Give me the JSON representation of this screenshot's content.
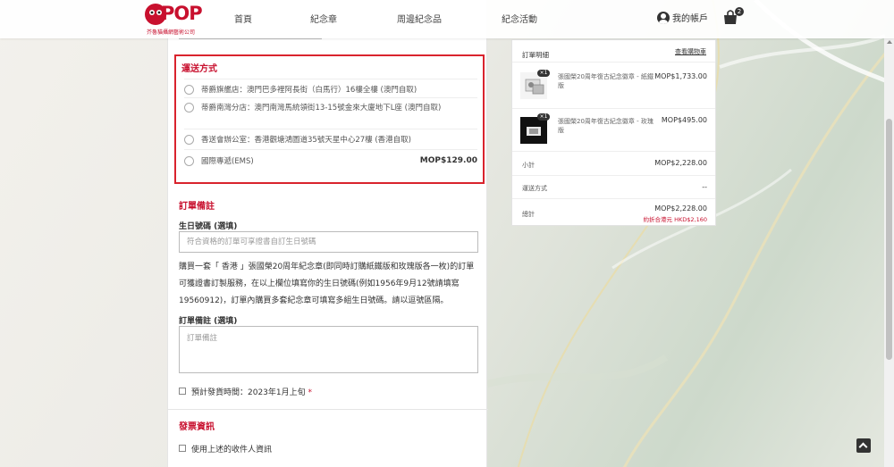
{
  "header": {
    "logo_text": "POP",
    "logo_subtitle": "芥魯貓攝網藝術公司",
    "nav": [
      "首頁",
      "紀念章",
      "周邊紀念品",
      "紀念活動"
    ],
    "account_label": "我的帳戶",
    "cart_count": "2"
  },
  "shipping": {
    "title": "運送方式",
    "options": [
      {
        "label": "蒂爵旗艦店：澳門巴多裡阿長街（白馬行）16樓全樓 (澳門自取)",
        "price": ""
      },
      {
        "label": "蒂爵南灣分店：澳門南灣馬統領街13-15號金來大廈地下L座 (澳門自取)",
        "price": ""
      },
      {
        "label": "香送會辦公室：香港觀塘鴻圖道35號天星中心27樓 (香港自取)",
        "price": ""
      },
      {
        "label": "國際專遞(EMS)",
        "price": "MOP$129.00"
      }
    ]
  },
  "notes": {
    "title": "訂單備註",
    "birthday_label": "生日號碼 (選填)",
    "birthday_placeholder": "符合資格的訂單可享證書自訂生日號碼",
    "paragraph": "購買一套「 香港 」張國榮20周年紀念章(即同時訂購紙鐵版和玫瑰版各一枚)的訂單可獲證書訂製服務，在以上欄位填寫你的生日號碼(例如1956年9月12號請填寫19560912)，訂單內購買多套紀念章可填寫多組生日號碼。請以逗號區隔。",
    "order_note_label": "訂單備註 (選填)",
    "order_note_placeholder": "訂單備註",
    "ship_time_label": "預計發貨時間：2023年1月上旬",
    "required_mark": "*"
  },
  "invoice": {
    "title": "發票資訊",
    "use_above_label": "使用上述的收件人資訊"
  },
  "summary": {
    "title": "訂單明細",
    "edit": "查看購物車",
    "items": [
      {
        "qty": "×1",
        "name": "張國榮20周年復古紀念徽章 - 紙鐵版",
        "price": "MOP$1,733.00"
      },
      {
        "qty": "×1",
        "name": "張國榮20周年復古紀念徽章 - 玫瑰版",
        "price": "MOP$495.00"
      }
    ],
    "subtotal_label": "小計",
    "subtotal": "MOP$2,228.00",
    "shipping_label": "運送方式",
    "shipping_value": "--",
    "total_label": "總計",
    "total": "MOP$2,228.00",
    "total_note": "約折合港元 HKD$2,160"
  },
  "colors": {
    "accent": "#c8102e",
    "highlight_border": "#d9232d"
  }
}
